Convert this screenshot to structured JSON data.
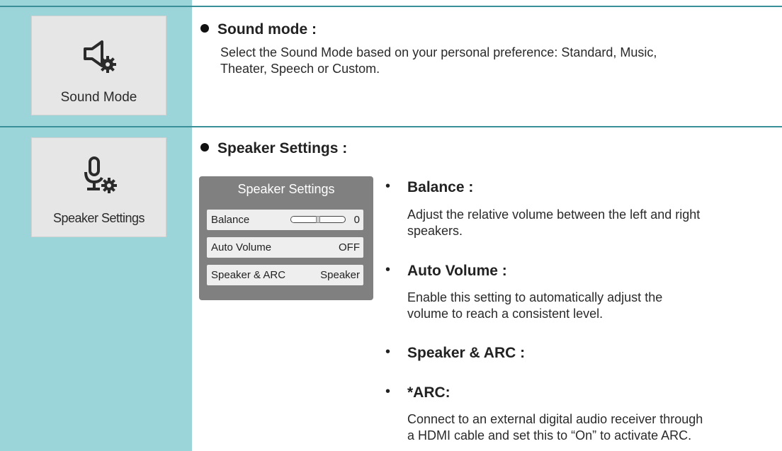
{
  "sections": [
    {
      "tile_label": "Sound Mode",
      "icon": "speaker-gear-icon",
      "heading": "Sound mode :",
      "description_lines": [
        "Select the Sound Mode based on your personal preference: Standard, Music,",
        "Theater, Speech or Custom."
      ]
    },
    {
      "tile_label": "Speaker Settings",
      "icon": "microphone-gear-icon",
      "heading": "Speaker Settings :"
    }
  ],
  "menu": {
    "title": "Speaker Settings",
    "rows": [
      {
        "label": "Balance",
        "value": "0",
        "slider_fraction": 0.5
      },
      {
        "label": "Auto Volume",
        "value": "OFF"
      },
      {
        "label": "Speaker & ARC",
        "value": "Speaker"
      }
    ]
  },
  "items": [
    {
      "title": "Balance :",
      "lines": [
        "Adjust the relative volume between the left and right",
        "speakers."
      ]
    },
    {
      "title": "Auto Volume :",
      "lines": [
        "Enable this setting to automatically adjust the",
        "volume to reach a consistent level."
      ]
    },
    {
      "title": "Speaker & ARC :",
      "lines": []
    },
    {
      "title": "*ARC:",
      "lines": [
        "Connect to an external digital audio receiver through",
        "a HDMI cable and set this to “On” to activate ARC."
      ]
    }
  ],
  "colors": {
    "left_column": "#9bd4d9",
    "divider": "#3a8f99",
    "menu_bg": "#808080"
  }
}
